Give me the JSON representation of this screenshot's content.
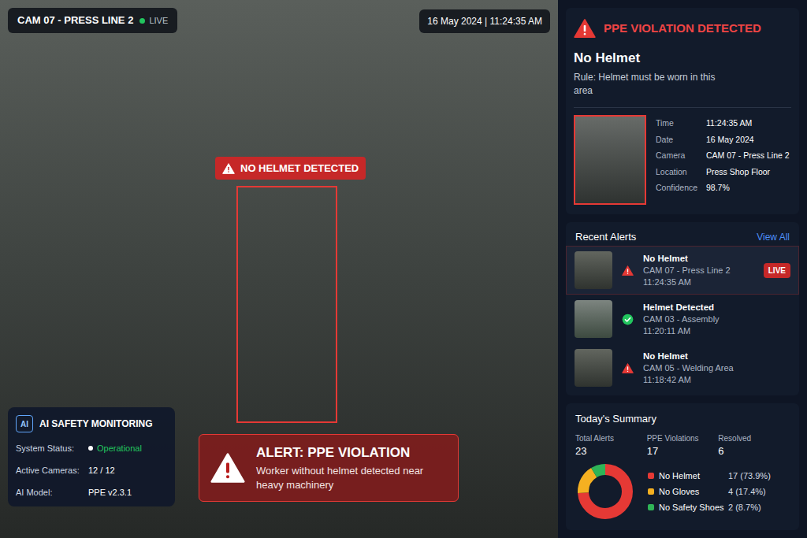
{
  "camera_feed": {
    "camera": "CAM 07 - PRESS LINE 2",
    "live": {
      "label": "LIVE",
      "on": true
    },
    "timestamp": "16 May 2024 | 11:24:35 AM",
    "detection": {
      "label": "NO HELMET DETECTED"
    },
    "alert": {
      "title": "ALERT: PPE VIOLATION",
      "message": "Worker without helmet detected near heavy machinery"
    },
    "monitoring": {
      "chip": "AI",
      "title": "AI SAFETY MONITORING",
      "rows": [
        {
          "label": "System Status:",
          "value": "Operational",
          "color": "#22c55e",
          "dot": true
        },
        {
          "label": "Active Cameras:",
          "value": "12 / 12",
          "color": "#ffffff",
          "dot": false
        },
        {
          "label": "AI Model:",
          "value": "PPE v2.3.1",
          "color": "#ffffff",
          "dot": false
        }
      ]
    }
  },
  "violation": {
    "title": "PPE VIOLATION DETECTED",
    "type": "No Helmet",
    "rule": "Rule: Helmet must be worn in this area",
    "details": [
      {
        "label": "Time",
        "value": "11:24:35 AM"
      },
      {
        "label": "Date",
        "value": "16 May 2024"
      },
      {
        "label": "Camera",
        "value": "CAM 07 - Press Line 2"
      },
      {
        "label": "Location",
        "value": "Press Shop Floor"
      },
      {
        "label": "Confidence",
        "value": "98.7%"
      }
    ]
  },
  "recent_alerts": {
    "title": "Recent Alerts",
    "view_all": "View All",
    "items": [
      {
        "title": "No Helmet",
        "camera": "CAM 07 - Press Line 2",
        "time": "11:24:35 AM",
        "kind": "violation",
        "badge": "LIVE",
        "selected": true
      },
      {
        "title": "Helmet Detected",
        "camera": "CAM 03 - Assembly",
        "time": "11:20:11 AM",
        "kind": "ok",
        "selected": false
      },
      {
        "title": "No Helmet",
        "camera": "CAM 05 - Welding Area",
        "time": "11:18:42 AM",
        "kind": "violation",
        "selected": false
      }
    ]
  },
  "summary": {
    "title": "Today's Summary",
    "stats": [
      {
        "label": "Total Alerts",
        "value": "23"
      },
      {
        "label": "PPE Violations",
        "value": "17"
      },
      {
        "label": "Resolved",
        "value": "6"
      }
    ],
    "chart": {
      "values": [
        17,
        4,
        2
      ]
    },
    "legend": [
      {
        "label": "No Helmet",
        "value": "17 (73.9%)",
        "color": "#e53935"
      },
      {
        "label": "No Gloves",
        "value": "4 (17.4%)",
        "color": "#f5b021"
      },
      {
        "label": "No Safety Shoes",
        "value": "2 (8.7%)",
        "color": "#2fb457"
      }
    ]
  }
}
